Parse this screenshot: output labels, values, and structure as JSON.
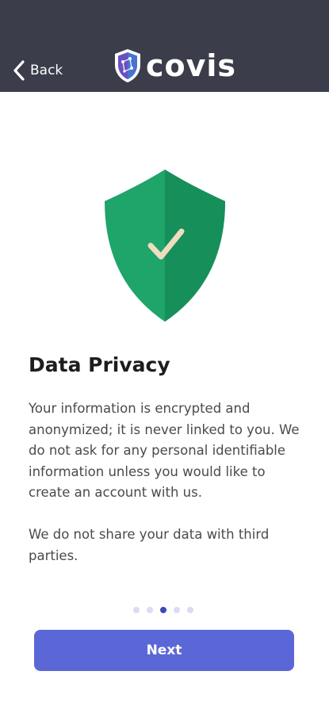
{
  "header": {
    "back_label": "Back",
    "back_icon": "chevron-left-icon",
    "logo_icon": "covis-shield-logo-icon",
    "logo_text": "covis",
    "background": "#3b3e4a"
  },
  "hero": {
    "icon": "shield-check-icon",
    "shield_colors": [
      "#1fa46a",
      "#178f5a"
    ],
    "check_color": "#f0dcc0"
  },
  "content": {
    "title": "Data Privacy",
    "paragraph_1": "Your information is encrypted and anonymized; it is never linked to you. We do not ask for any personal identifiable information unless you would like to create an account with us.",
    "paragraph_2": "We do not share your data with third parties."
  },
  "pagination": {
    "total": 5,
    "active_index": 2
  },
  "footer": {
    "next_label": "Next",
    "button_color": "#5b67d6"
  }
}
